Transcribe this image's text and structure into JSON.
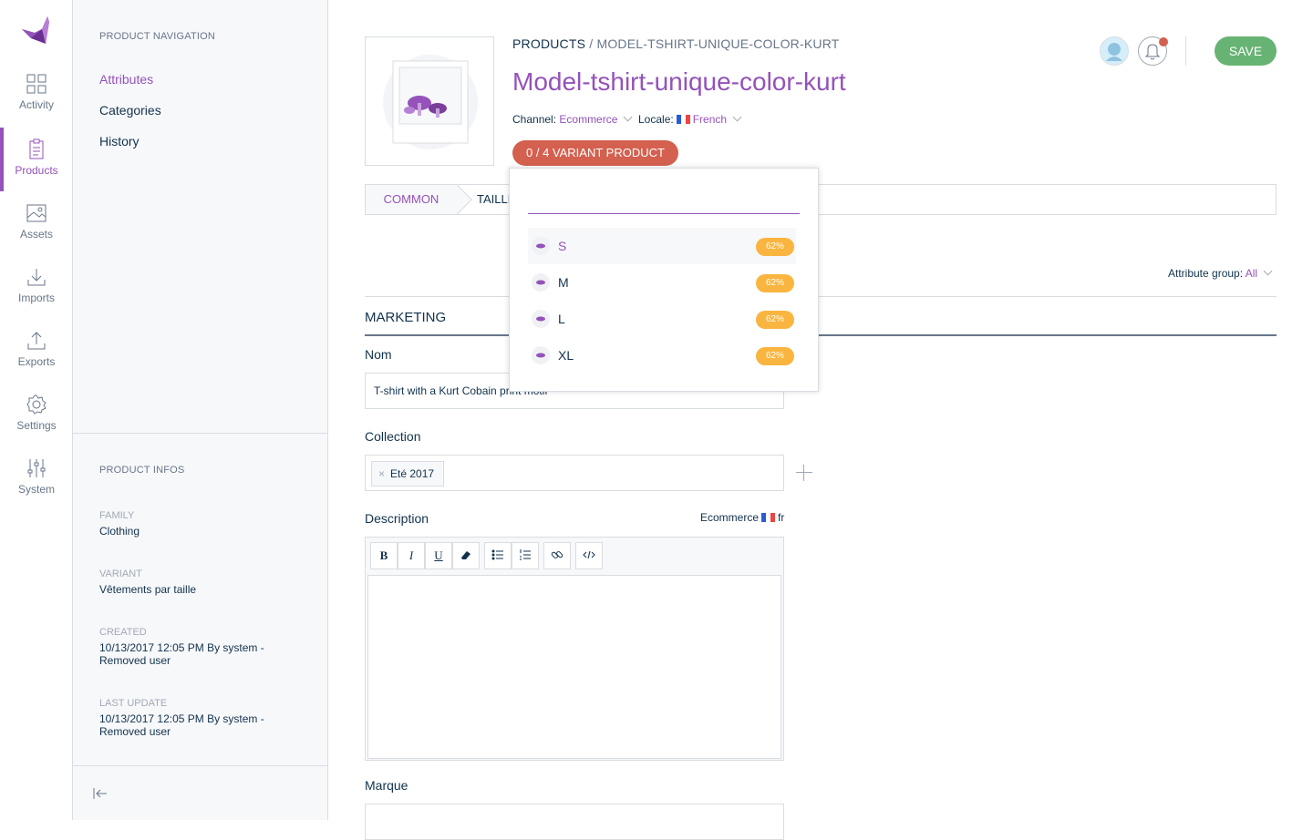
{
  "rail": {
    "items": [
      {
        "label": "Activity",
        "icon": "activity-icon"
      },
      {
        "label": "Products",
        "icon": "products-icon"
      },
      {
        "label": "Assets",
        "icon": "assets-icon"
      },
      {
        "label": "Imports",
        "icon": "imports-icon"
      },
      {
        "label": "Exports",
        "icon": "exports-icon"
      },
      {
        "label": "Settings",
        "icon": "settings-icon"
      },
      {
        "label": "System",
        "icon": "system-icon"
      }
    ],
    "active": "Products"
  },
  "column": {
    "nav_title": "PRODUCT NAVIGATION",
    "nav_items": [
      {
        "label": "Attributes"
      },
      {
        "label": "Categories"
      },
      {
        "label": "History"
      }
    ],
    "infos_title": "PRODUCT INFOS",
    "infos": [
      {
        "label": "FAMILY",
        "value": "Clothing"
      },
      {
        "label": "VARIANT",
        "value": "Vêtements par taille"
      },
      {
        "label": "CREATED",
        "value": "10/13/2017 12:05 PM By system - Removed user"
      },
      {
        "label": "LAST UPDATE",
        "value": "10/13/2017 12:05 PM By system - Removed user"
      }
    ]
  },
  "header": {
    "breadcrumb_root": "PRODUCTS",
    "breadcrumb_sep": " / ",
    "breadcrumb_leaf": "MODEL-TSHIRT-UNIQUE-COLOR-KURT",
    "title": "Model-tshirt-unique-color-kurt",
    "channel_label": "Channel:",
    "channel_value": "Ecommerce",
    "locale_label": "Locale:",
    "locale_value": "French",
    "variant_button": "0 / 4 VARIANT PRODUCT",
    "save_label": "SAVE"
  },
  "tabs": [
    {
      "label": "COMMON"
    },
    {
      "label": "TAILLE"
    }
  ],
  "attribute_group": {
    "label": "Attribute group:",
    "value": "All"
  },
  "section_title": "MARKETING",
  "fields": {
    "nom": {
      "label": "Nom",
      "value": "T-shirt with a Kurt Cobain print motif"
    },
    "collection": {
      "label": "Collection",
      "tag": "Eté 2017"
    },
    "description": {
      "label": "Description",
      "scope_channel": "Ecommerce",
      "scope_locale": "fr"
    },
    "marque": {
      "label": "Marque"
    }
  },
  "editor_toolbar": [
    "B",
    "I",
    "U"
  ],
  "variant_dropdown": {
    "search_placeholder": "",
    "items": [
      {
        "label": "S",
        "completeness": "62%"
      },
      {
        "label": "M",
        "completeness": "62%"
      },
      {
        "label": "L",
        "completeness": "62%"
      },
      {
        "label": "XL",
        "completeness": "62%"
      }
    ],
    "highlighted": "S"
  },
  "colors": {
    "accent": "#9452ba",
    "save": "#67b373",
    "variant": "#d4604f",
    "badge": "#f9b53f"
  }
}
